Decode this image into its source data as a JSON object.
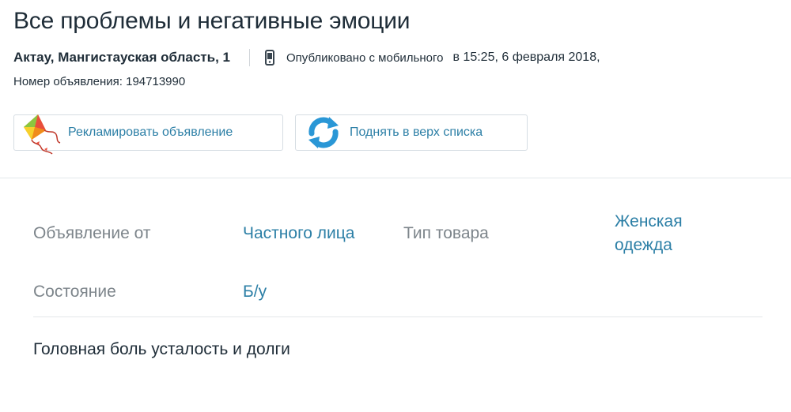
{
  "ad": {
    "title": "Все проблемы и негативные эмоции",
    "location": "Актау, Мангистауская область, 1",
    "published_via": "Опубликовано с мобильного",
    "published_at": "в 15:25, 6 февраля 2018,",
    "ad_number": "Номер объявления: 194713990"
  },
  "actions": {
    "promote_label": "Рекламировать объявление",
    "lift_label": "Поднять в верх списка"
  },
  "params": {
    "from_label": "Объявление от",
    "from_value": "Частного лица",
    "type_label": "Тип товара",
    "type_value_line1": "Женская",
    "type_value_line2": "одежда",
    "condition_label": "Состояние",
    "condition_value": "Б/у"
  },
  "description": "Головная боль усталость и долги",
  "icons": {
    "phone": "mobile-phone-icon",
    "kite": "kite-icon",
    "refresh": "refresh-arrows-icon"
  },
  "colors": {
    "link": "#2c7fa6",
    "text": "#1f2d38",
    "muted": "#7d858b",
    "border": "#d6dde3"
  }
}
